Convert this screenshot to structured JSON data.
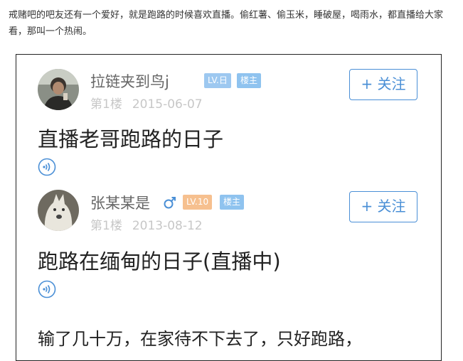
{
  "article": {
    "intro_text": "戒赌吧的吧友还有一个爱好，就是跑路的时候喜欢直播。偷红薯、偷玉米，睡破屋，喝雨水，都直播给大家看，那叫一个热闹。"
  },
  "posts": [
    {
      "username": "拉链夹到鸟j",
      "level_badge": "LV.日",
      "owner_badge": "楼主",
      "floor": "第1楼",
      "date": "2015-06-07",
      "follow_label": "+ 关注",
      "title": "直播老哥跑路的日子"
    },
    {
      "username": "张某某是",
      "level_badge": "LV.10",
      "owner_badge": "楼主",
      "floor": "第1楼",
      "date": "2013-08-12",
      "follow_label": "+ 关注",
      "title": "跑路在缅甸的日子(直播中)",
      "body": "输了几十万，在家待不下去了，只好跑路，"
    }
  ],
  "colors": {
    "accent": "#4a8fd6",
    "level_badge_blue": "#9dc8f0",
    "level_badge_orange": "#f6c08f",
    "owner_badge": "#8fc3ef"
  }
}
